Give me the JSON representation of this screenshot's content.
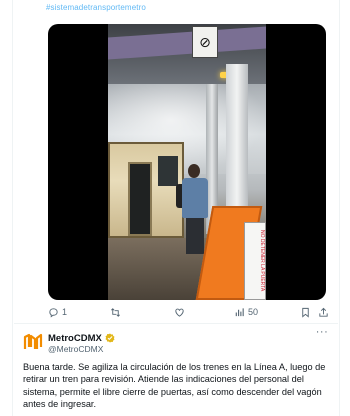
{
  "top": {
    "hashtag_text": "#sistemadetransportemetro"
  },
  "media": {
    "type": "video",
    "scene_sign_icon": "no-smoking-sign-icon",
    "gate_panel_text": "NO DETENER LA PUERTA"
  },
  "actions": {
    "reply_count": "1",
    "retweet_count": "",
    "like_count": "",
    "views_count": "50",
    "icons": [
      "reply-icon",
      "retweet-icon",
      "like-icon",
      "views-icon",
      "bookmark-icon",
      "share-icon"
    ]
  },
  "tweet": {
    "account_name": "MetroCDMX",
    "handle": "@MetroCDMX",
    "verified_badge_color": "#e2b719",
    "logo_color": "#f28c00",
    "more_label": "···",
    "text": "Buena tarde. Se agiliza la circulación de los trenes en la Línea A, luego de retirar un tren para revisión. Atiende las indicaciones del personal del sistema, permite el libre cierre de puertas, así como descender del vagón antes de ingresar."
  },
  "colors": {
    "link": "#1d9bf0",
    "muted": "#536471",
    "text": "#0f1419"
  }
}
